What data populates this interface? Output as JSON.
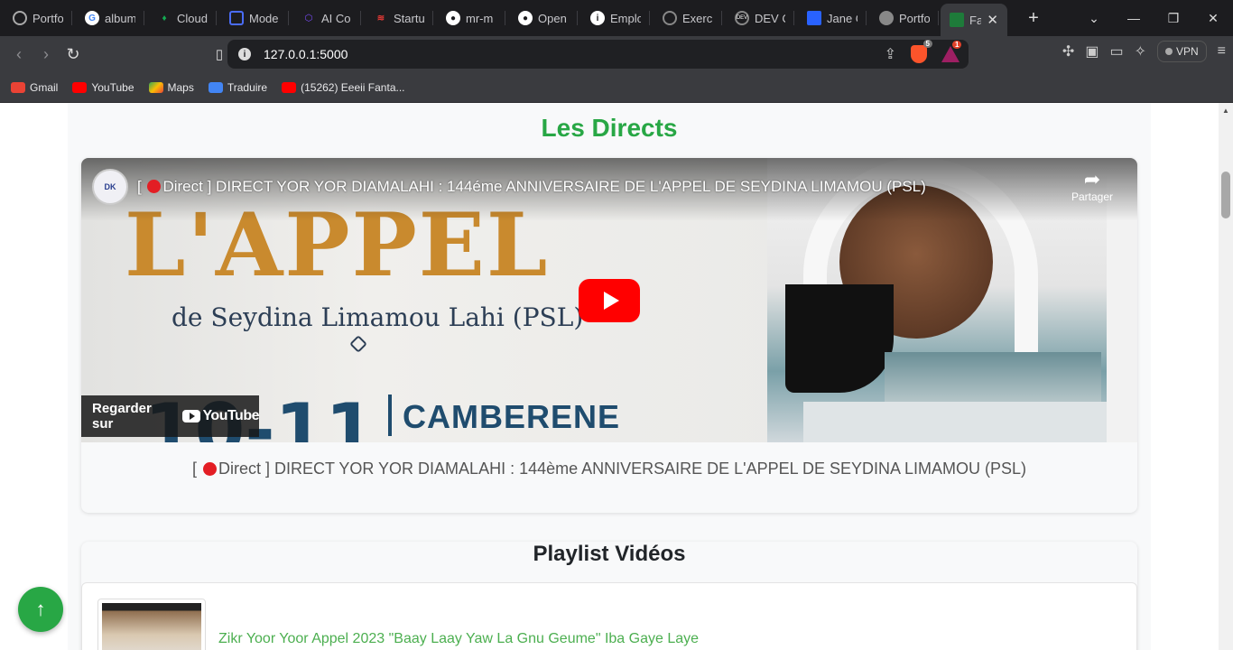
{
  "browser": {
    "tabs": [
      {
        "label": "Portfo",
        "icon": "portfolio-icon",
        "color": "#666666"
      },
      {
        "label": "album",
        "icon": "google-icon",
        "color": "#4285f4"
      },
      {
        "label": "Cloud",
        "icon": "mongodb-icon",
        "color": "#13aa52"
      },
      {
        "label": "Mode",
        "icon": "model-icon",
        "color": "#4a6cf7"
      },
      {
        "label": "AI Co",
        "icon": "ai-code-icon",
        "color": "#7c4dff"
      },
      {
        "label": "Startu",
        "icon": "startup-icon",
        "color": "#e53935"
      },
      {
        "label": "mr-m",
        "icon": "github-icon",
        "color": "#ffffff"
      },
      {
        "label": "Open",
        "icon": "github-icon",
        "color": "#ffffff"
      },
      {
        "label": "Emplo",
        "icon": "info-icon",
        "color": "#ffffff"
      },
      {
        "label": "Exerci",
        "icon": "exercise-icon",
        "color": "#888888"
      },
      {
        "label": "DEV C",
        "icon": "dev-icon",
        "color": "#888888"
      },
      {
        "label": "Jane C",
        "icon": "jane-icon",
        "color": "#2962ff"
      },
      {
        "label": "Portfo",
        "icon": "globe-icon",
        "color": "#888888"
      }
    ],
    "active_tab": {
      "label": "Fa",
      "close": "✕"
    },
    "new_tab": "+",
    "window_controls": {
      "dropdown": "⌄",
      "minimize": "—",
      "restore": "❐",
      "close": "✕"
    },
    "url": "127.0.0.1:5000",
    "brave_badge": "5",
    "rewards_badge": "1",
    "vpn_label": "VPN",
    "bookmarks": [
      {
        "label": "Gmail",
        "color": "#ea4335"
      },
      {
        "label": "YouTube",
        "color": "#ff0000"
      },
      {
        "label": "Maps",
        "color": "#34a853"
      },
      {
        "label": "Traduire",
        "color": "#4285f4"
      },
      {
        "label": "(15262) Eeeii Fanta...",
        "color": "#ff0000"
      }
    ]
  },
  "page": {
    "heading": "Les Directs",
    "video": {
      "channel_badge": "DK",
      "title_prefix": "[",
      "title_live": "Direct ]",
      "title_text": "DIRECT YOR YOR DIAMALAHI : 144éme ANNIVERSAIRE DE L'APPEL DE SEYDINA LIMAMOU (PSL)",
      "share_label": "Partager",
      "watch_on": "Regarder sur",
      "youtube_label": "YouTube",
      "thumb_big": "L'APPEL",
      "thumb_sub": "de Seydina Limamou Lahi (PSL)",
      "thumb_date": "10-11",
      "thumb_place": "CAMBERENE"
    },
    "caption_prefix": "[",
    "caption_live": "Direct ]",
    "caption_text": "DIRECT YOR YOR DIAMALAHI : 144ème ANNIVERSAIRE DE L'APPEL DE SEYDINA LIMAMOU (PSL)",
    "playlist": {
      "title": "Playlist Vidéos",
      "items": [
        {
          "title": "Zikr Yoor Yoor Appel 2023 \"Baay Laay Yaw La Gnu Geume\" Iba Gaye Laye"
        }
      ]
    },
    "back_to_top": "↑"
  }
}
